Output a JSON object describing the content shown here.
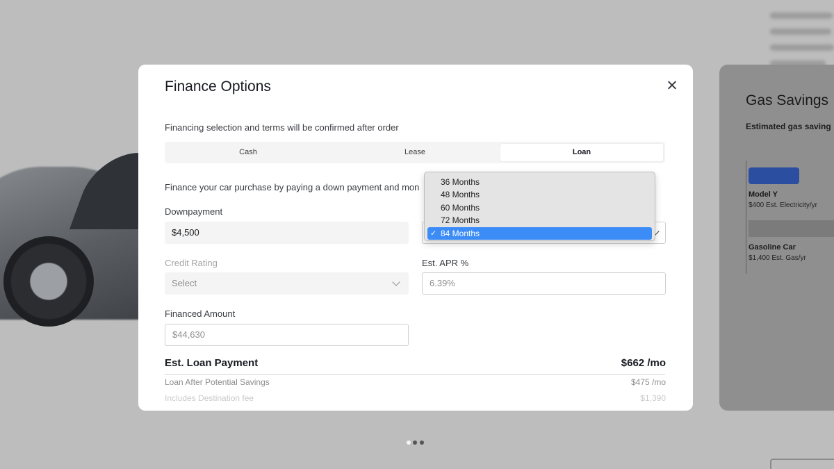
{
  "modal": {
    "title": "Finance Options",
    "subtitle": "Financing selection and terms will be confirmed after order",
    "tabs": [
      {
        "label": "Cash",
        "active": false
      },
      {
        "label": "Lease",
        "active": false
      },
      {
        "label": "Loan",
        "active": true
      }
    ],
    "description": "Finance your car purchase by paying a down payment and mon",
    "downpayment": {
      "label": "Downpayment",
      "value": "$4,500"
    },
    "term": {
      "options": [
        "36 Months",
        "48 Months",
        "60 Months",
        "72 Months",
        "84 Months"
      ],
      "selected": "84 Months",
      "check": "✓"
    },
    "credit_rating": {
      "label": "Credit Rating",
      "value": "Select"
    },
    "apr": {
      "label": "Est. APR %",
      "value": "6.39%"
    },
    "financed_amount": {
      "label": "Financed Amount",
      "value": "$44,630"
    },
    "loan_payment": {
      "label": "Est. Loan Payment",
      "value": "$662 /mo"
    },
    "after_savings": {
      "label": "Loan After Potential Savings",
      "value": "$475 /mo"
    },
    "destination": {
      "label": "Includes Destination fee",
      "value": "$1,390"
    }
  },
  "gas_savings": {
    "title": "Gas Savings",
    "subtitle": "Estimated gas saving",
    "ev": {
      "name": "Model Y",
      "value": "$400 Est. Electricity/yr",
      "color": "#2c4ea1"
    },
    "gas": {
      "name": "Gasoline Car",
      "value": "$1,400 Est. Gas/yr",
      "color": "#7b7b7b"
    }
  },
  "carousel": {
    "count": 3,
    "active_index": 0
  }
}
